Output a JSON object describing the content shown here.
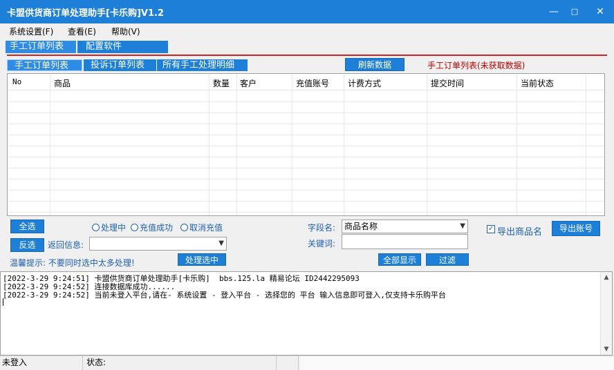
{
  "window": {
    "title": "卡盟供货商订单处理助手[卡乐购]V1.2",
    "minimize": "—",
    "maximize": "□",
    "close": "✕"
  },
  "menu": {
    "items": [
      "系统设置(F)",
      "查看(E)",
      "帮助(V)"
    ]
  },
  "main_tabs": [
    "手工订单列表",
    "配置软件"
  ],
  "sub_tabs": [
    "手工订单列表",
    "投诉订单列表",
    "所有手工处理明细"
  ],
  "refresh_button": "刷新数据",
  "list_status": "手工订单列表(未获取数据)",
  "table": {
    "columns": [
      "No",
      "商品",
      "数量",
      "客户",
      "充值账号",
      "计费方式",
      "提交时间",
      "当前状态"
    ],
    "rows": []
  },
  "controls": {
    "select_all": "全选",
    "invert_select": "反选",
    "radio_processing": "处理中",
    "radio_success": "充值成功",
    "radio_cancel": "取消充值",
    "return_info_label": "返回信息:",
    "return_info_value": "",
    "tip": "温馨提示: 不要同时选中太多处理!",
    "process_selected": "处理选中",
    "field_label": "字段名:",
    "field_value": "商品名称",
    "keyword_label": "关键词:",
    "keyword_value": "",
    "show_all": "全部显示",
    "filter": "过滤",
    "export_product_name_label": "导出商品名",
    "export_product_name_checked": true,
    "export_account": "导出账号"
  },
  "log": [
    "[2022-3-29 9:24:51] 卡盟供货商订单处理助手[卡乐购]  bbs.125.la 精易论坛 ID2442295093",
    "[2022-3-29 9:24:52] 连接数据库成功......",
    "[2022-3-29 9:24:52] 当前未登入平台,请在- 系统设置 - 登入平台 - 选择您的 平台 输入信息即可登入,仅支持卡乐购平台"
  ],
  "statusbar": {
    "login_status": "未登入",
    "state_label": "状态:"
  },
  "colors": {
    "accent": "#1e7fd8",
    "tab_line": "#d42020",
    "status_text": "#c00000"
  }
}
